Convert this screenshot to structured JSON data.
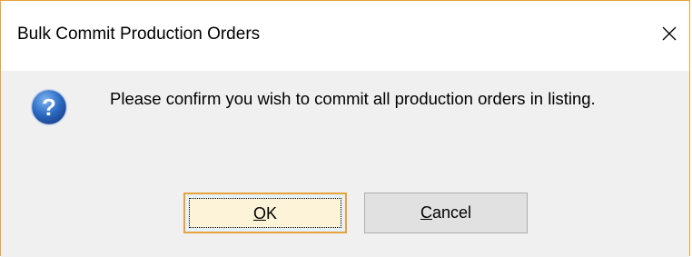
{
  "dialog": {
    "title": "Bulk Commit Production Orders",
    "close_icon": "close-icon",
    "icon": "question-icon",
    "message": "Please confirm you wish to commit all production orders in listing.",
    "buttons": {
      "ok": {
        "mnemonic": "O",
        "rest": "K"
      },
      "cancel": {
        "mnemonic": "C",
        "rest": "ancel"
      }
    }
  },
  "colors": {
    "focus_border": "#e8a33a",
    "icon_blue": "#1f5fb3",
    "dialog_bg": "#f0f0f0"
  }
}
